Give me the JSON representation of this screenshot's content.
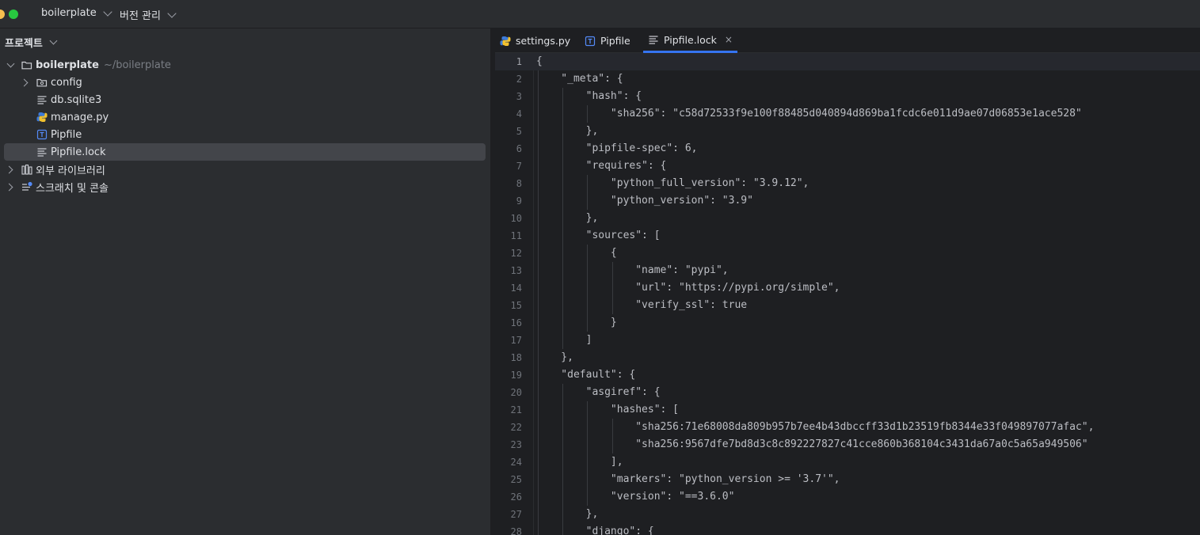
{
  "titlebar": {
    "project_name": "boilerplate",
    "vcs_menu": "버전 관리"
  },
  "project_panel": {
    "title": "프로젝트",
    "tree": [
      {
        "label": "boilerplate",
        "path": "~/boilerplate",
        "type": "folder",
        "expanded": true,
        "icon": "folder-icon"
      },
      {
        "label": "config",
        "type": "folder",
        "expanded": false,
        "icon": "package-folder-icon"
      },
      {
        "label": "db.sqlite3",
        "type": "file",
        "icon": "text-file-icon"
      },
      {
        "label": "manage.py",
        "type": "file",
        "icon": "python-file-icon"
      },
      {
        "label": "Pipfile",
        "type": "file",
        "icon": "toml-file-icon"
      },
      {
        "label": "Pipfile.lock",
        "type": "file",
        "icon": "text-file-icon",
        "selected": true
      },
      {
        "label": "외부 라이브러리",
        "type": "node",
        "expanded": false,
        "icon": "library-icon"
      },
      {
        "label": "스크래치 및 콘솔",
        "type": "node",
        "expanded": false,
        "icon": "scratches-icon"
      }
    ]
  },
  "editor": {
    "tabs": [
      {
        "label": "settings.py",
        "icon": "python-file-icon",
        "active": false
      },
      {
        "label": "Pipfile",
        "icon": "toml-file-icon",
        "active": false
      },
      {
        "label": "Pipfile.lock",
        "icon": "text-file-icon",
        "active": true,
        "close": "×"
      }
    ],
    "current_line": 1,
    "lines": [
      {
        "n": "1",
        "text": "{"
      },
      {
        "n": "2",
        "text": "    \"_meta\": {"
      },
      {
        "n": "3",
        "text": "        \"hash\": {"
      },
      {
        "n": "4",
        "text": "            \"sha256\": \"c58d72533f9e100f88485d040894d869ba1fcdc6e011d9ae07d06853e1ace528\""
      },
      {
        "n": "5",
        "text": "        },"
      },
      {
        "n": "6",
        "text": "        \"pipfile-spec\": 6,"
      },
      {
        "n": "7",
        "text": "        \"requires\": {"
      },
      {
        "n": "8",
        "text": "            \"python_full_version\": \"3.9.12\","
      },
      {
        "n": "9",
        "text": "            \"python_version\": \"3.9\""
      },
      {
        "n": "10",
        "text": "        },"
      },
      {
        "n": "11",
        "text": "        \"sources\": ["
      },
      {
        "n": "12",
        "text": "            {"
      },
      {
        "n": "13",
        "text": "                \"name\": \"pypi\","
      },
      {
        "n": "14",
        "text": "                \"url\": \"https://pypi.org/simple\","
      },
      {
        "n": "15",
        "text": "                \"verify_ssl\": true"
      },
      {
        "n": "16",
        "text": "            }"
      },
      {
        "n": "17",
        "text": "        ]"
      },
      {
        "n": "18",
        "text": "    },"
      },
      {
        "n": "19",
        "text": "    \"default\": {"
      },
      {
        "n": "20",
        "text": "        \"asgiref\": {"
      },
      {
        "n": "21",
        "text": "            \"hashes\": ["
      },
      {
        "n": "22",
        "text": "                \"sha256:71e68008da809b957b7ee4b43dbccff33d1b23519fb8344e33f049897077afac\","
      },
      {
        "n": "23",
        "text": "                \"sha256:9567dfe7bd8d3c8c892227827c41cce860b368104c3431da67a0c5a65a949506\""
      },
      {
        "n": "24",
        "text": "            ],"
      },
      {
        "n": "25",
        "text": "            \"markers\": \"python_version >= '3.7'\","
      },
      {
        "n": "26",
        "text": "            \"version\": \"==3.6.0\""
      },
      {
        "n": "27",
        "text": "        },"
      },
      {
        "n": "28",
        "text": "        \"django\": {"
      }
    ]
  },
  "colors": {
    "background": "#1e1f22",
    "panel": "#2b2d30",
    "accent": "#3574f0",
    "selection": "#43454a",
    "text": "#dfe1e5",
    "muted": "#7a7e85"
  }
}
